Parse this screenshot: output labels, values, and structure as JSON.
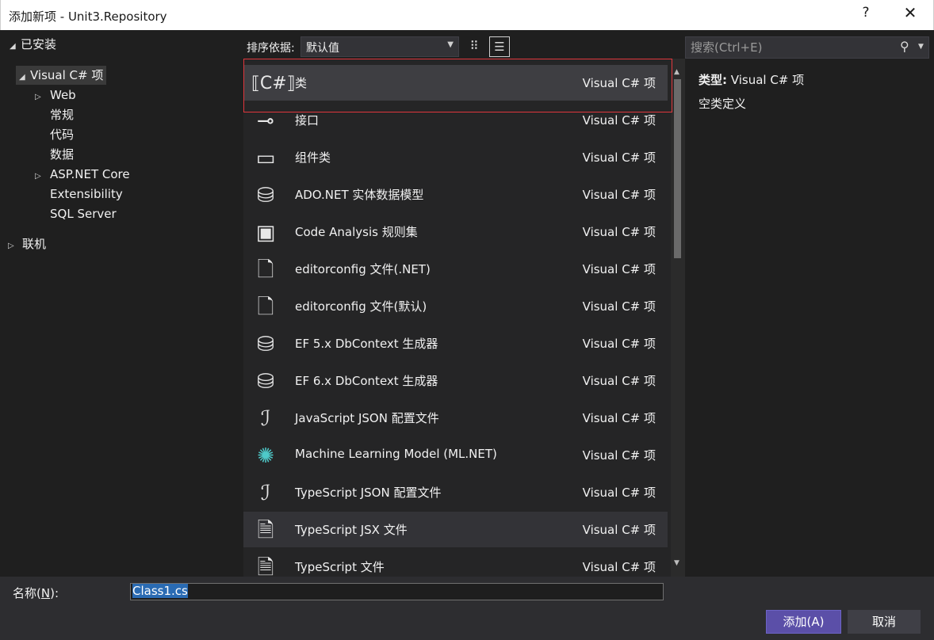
{
  "window": {
    "title": "添加新项 - Unit3.Repository",
    "help_label": "?",
    "close_label": "✕"
  },
  "tree": {
    "installed": "已安装",
    "visual_csharp": "Visual C# 项",
    "web": "Web",
    "general": "常规",
    "code": "代码",
    "data": "数据",
    "aspnet_core": "ASP.NET Core",
    "extensibility": "Extensibility",
    "sql_server": "SQL Server",
    "online": "联机"
  },
  "toolbar": {
    "sort_label": "排序依据:",
    "sort_value": "默认值"
  },
  "items": [
    {
      "name": "类",
      "type": "Visual C# 项",
      "icon": "class-icon"
    },
    {
      "name": "接口",
      "type": "Visual C# 项",
      "icon": "interface-icon"
    },
    {
      "name": "组件类",
      "type": "Visual C# 项",
      "icon": "component-class-icon"
    },
    {
      "name": "ADO.NET 实体数据模型",
      "type": "Visual C# 项",
      "icon": "entity-model-icon"
    },
    {
      "name": "Code Analysis 规则集",
      "type": "Visual C# 项",
      "icon": "ruleset-icon"
    },
    {
      "name": "editorconfig 文件(.NET)",
      "type": "Visual C# 项",
      "icon": "editorconfig-icon"
    },
    {
      "name": "editorconfig 文件(默认)",
      "type": "Visual C# 项",
      "icon": "editorconfig-icon"
    },
    {
      "name": "EF 5.x DbContext 生成器",
      "type": "Visual C# 项",
      "icon": "dbcontext-generator-icon"
    },
    {
      "name": "EF 6.x DbContext 生成器",
      "type": "Visual C# 项",
      "icon": "dbcontext-generator-icon"
    },
    {
      "name": "JavaScript JSON 配置文件",
      "type": "Visual C# 项",
      "icon": "json-config-icon"
    },
    {
      "name": "Machine Learning Model (ML.NET)",
      "type": "Visual C# 项",
      "icon": "ml-model-icon"
    },
    {
      "name": "TypeScript JSON 配置文件",
      "type": "Visual C# 项",
      "icon": "json-config-icon"
    },
    {
      "name": "TypeScript JSX 文件",
      "type": "Visual C# 项",
      "icon": "typescript-file-icon"
    },
    {
      "name": "TypeScript 文件",
      "type": "Visual C# 项",
      "icon": "typescript-file-icon"
    }
  ],
  "search": {
    "placeholder": "搜索(Ctrl+E)"
  },
  "details": {
    "type_label": "类型:",
    "type_value": "Visual C# 项",
    "description": "空类定义"
  },
  "footer": {
    "name_label_prefix": "名称(",
    "name_label_key": "N",
    "name_label_suffix": "):",
    "name_value": "Class1.cs",
    "add_label": "添加(A)",
    "cancel_label": "取消"
  }
}
